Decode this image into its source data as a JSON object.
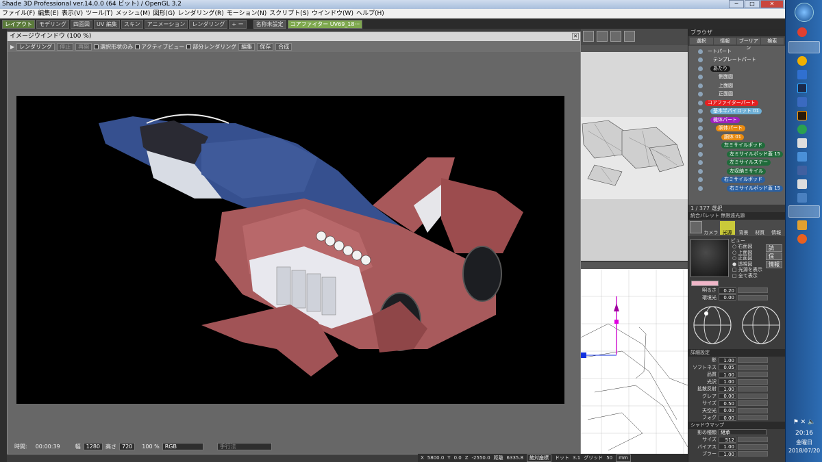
{
  "window": {
    "title": "Shade 3D Professional ver.14.0.0 (64 ビット) / OpenGL 3.2"
  },
  "menu": [
    "ファイル(F)",
    "編集(E)",
    "表示(V)",
    "ツール(T)",
    "メッシュ(M)",
    "図形(G)",
    "レンダリング(R)",
    "モーション(N)",
    "スクリプト(S)",
    "ウインドウ(W)",
    "ヘルプ(H)"
  ],
  "mode_tabs": [
    "レイアウト",
    "モデリング",
    "四面図",
    "UV 編集",
    "スキン",
    "アニメーション",
    "レンダリング"
  ],
  "mode_tab_extra": "+ ー",
  "doc_tabs": [
    "名称未設定",
    "コアファイター UV69_18···"
  ],
  "image_window": {
    "title": "イメージウインドウ (100 %)",
    "buttons": [
      "レンダリング",
      "停止",
      "再開"
    ],
    "checks": [
      "選択形状のみ",
      "アクティブビュー",
      "部分レンダリング"
    ],
    "actions": [
      "編集",
      "保存",
      "合成"
    ],
    "time_label": "時間:",
    "time": "00:00:39",
    "width_label": "幅",
    "width": "1280",
    "height_label": "高さ",
    "height": "720",
    "zoom": "100 %",
    "color_mode": "RGB",
    "method": "手行法"
  },
  "browser": {
    "header": "ブラウザ",
    "tabs": [
      "選択",
      "情報",
      "ブーリアン",
      "検索"
    ],
    "items": [
      {
        "label": "ートパート",
        "color": "#5d5d5d",
        "indent": 0
      },
      {
        "label": "テンプレートパート",
        "color": "#5d5d5d",
        "indent": 1
      },
      {
        "label": "あたり",
        "color": "#1a1a1a",
        "indent": 1
      },
      {
        "label": "側面図",
        "color": "#5d5d5d",
        "indent": 2
      },
      {
        "label": "上面図",
        "color": "#5d5d5d",
        "indent": 2
      },
      {
        "label": "正面図",
        "color": "#5d5d5d",
        "indent": 2
      },
      {
        "label": "コアファイターパート",
        "color": "#e52020",
        "indent": 0
      },
      {
        "label": "基本半パイロット 01",
        "color": "#6fb0d6",
        "indent": 1
      },
      {
        "label": "機体パート",
        "color": "#a020c0",
        "indent": 1
      },
      {
        "label": "胴体パート",
        "color": "#e88a10",
        "indent": 2
      },
      {
        "label": "胴体 01",
        "color": "#e88a10",
        "indent": 3
      },
      {
        "label": "左ミサイルポッド",
        "color": "#1f6b3a",
        "indent": 3
      },
      {
        "label": "左ミサイルポッド蓋 15",
        "color": "#1f6b3a",
        "indent": 4
      },
      {
        "label": "左ミサイルステー",
        "color": "#1f6b3a",
        "indent": 4
      },
      {
        "label": "左収納ミサイル",
        "color": "#1f6b3a",
        "indent": 4
      },
      {
        "label": "右ミサイルポッド",
        "color": "#2a5fa0",
        "indent": 3
      },
      {
        "label": "右ミサイルポッド蓋 15",
        "color": "#2a5fa0",
        "indent": 4
      }
    ],
    "count": "1 / 377 選択"
  },
  "palette": {
    "header": "統合パレット  無限遠光源",
    "tabs": [
      "カメラ",
      "光源",
      "背景",
      "材質",
      "情報"
    ],
    "view_label": "ビュー",
    "views": [
      "右面図",
      "上面図",
      "正面図",
      "透視図"
    ],
    "view_buttons": [
      "読",
      "保",
      "情報"
    ],
    "options": [
      "光源を表示",
      "全て表示"
    ],
    "brightness_label": "明るさ",
    "brightness": "0.20",
    "ambient_label": "環境光",
    "ambient": "0.00",
    "detail_header": "詳細設定",
    "details": [
      {
        "label": "影",
        "value": "1.00"
      },
      {
        "label": "ソフトネス",
        "value": "0.05"
      },
      {
        "label": "品質",
        "value": "1.00"
      },
      {
        "label": "光沢",
        "value": "1.00"
      },
      {
        "label": "拡散反射",
        "value": "1.00"
      },
      {
        "label": "グレア",
        "value": "0.00"
      },
      {
        "label": "サイズ",
        "value": "0.50"
      },
      {
        "label": "天空光",
        "value": "0.00"
      },
      {
        "label": "フォグ",
        "value": "0.00"
      }
    ],
    "shadow_header": "シャドウマップ",
    "shadow_type_label": "影の種類",
    "shadow_type": "継承",
    "shadow_rows": [
      {
        "label": "サイズ",
        "value": "512"
      },
      {
        "label": "バイアス",
        "value": "1.00"
      },
      {
        "label": "ブラー",
        "value": "1.00"
      }
    ]
  },
  "statusbar": {
    "x_label": "X",
    "x": "5800.0",
    "y_label": "Y",
    "y": "0.0",
    "z_label": "Z",
    "z": "-2550.0",
    "dist_label": "距離",
    "dist": "6335.8",
    "coord_mode": "絶対座標",
    "dot_label": "ドット",
    "dot": "3.1",
    "grid_label": "グリッド",
    "grid": "50",
    "unit": "mm"
  },
  "clock": {
    "time": "20:16",
    "day": "金曜日",
    "date": "2018/07/20"
  }
}
